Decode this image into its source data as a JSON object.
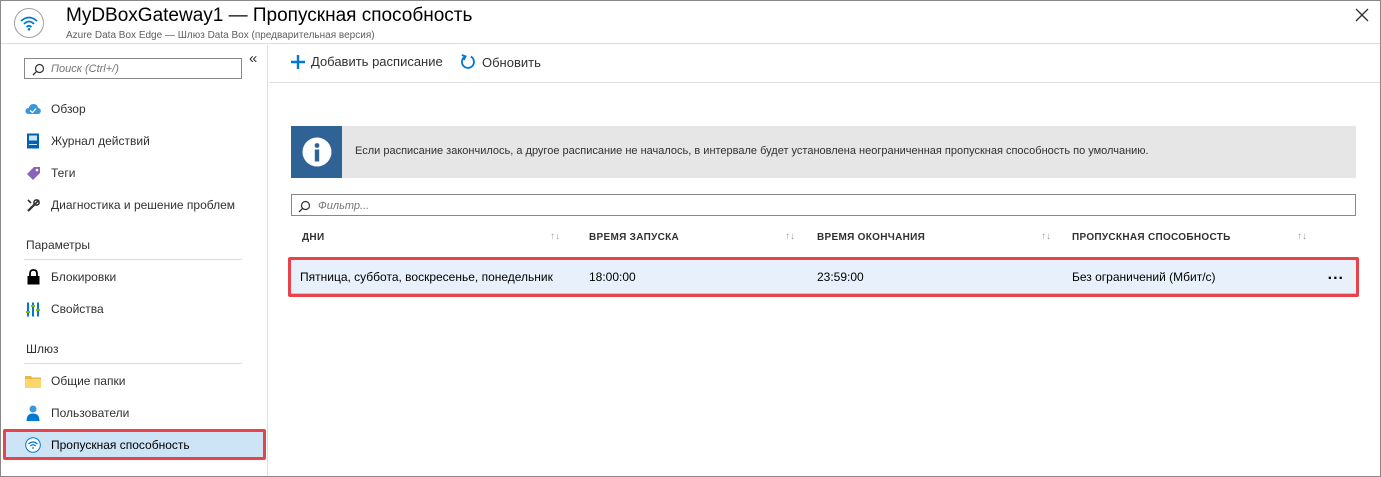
{
  "header": {
    "title": "MyDBoxGateway1 — Пропускная способность",
    "subtitle": "Azure Data Box Edge — Шлюз Data Box (предварительная версия)",
    "icon": "wifi-icon",
    "close_icon": "close-icon"
  },
  "sidebar": {
    "search_placeholder": "Поиск (Ctrl+/)",
    "collapse_label": "«",
    "items": [
      {
        "label": "Обзор",
        "icon": "cloud-icon"
      },
      {
        "label": "Журнал действий",
        "icon": "journal-icon"
      },
      {
        "label": "Теги",
        "icon": "tag-icon"
      },
      {
        "label": "Диагностика и решение проблем",
        "icon": "wrench-icon"
      }
    ],
    "section_parameters": "Параметры",
    "parameter_items": [
      {
        "label": "Блокировки",
        "icon": "lock-icon"
      },
      {
        "label": "Свойства",
        "icon": "properties-icon"
      }
    ],
    "section_gateway": "Шлюз",
    "gateway_items": [
      {
        "label": "Общие папки",
        "icon": "folder-icon"
      },
      {
        "label": "Пользователи",
        "icon": "user-icon"
      },
      {
        "label": "Пропускная способность",
        "icon": "wifi-icon",
        "active": true
      }
    ]
  },
  "toolbar": {
    "add_schedule": "Добавить расписание",
    "refresh": "Обновить"
  },
  "info": {
    "text": "Если расписание закончилось, а другое расписание не началось, в интервале будет установлена неограниченная пропускная способность по умолчанию."
  },
  "filter": {
    "placeholder": "Фильтр..."
  },
  "table": {
    "columns": [
      "ДНИ",
      "ВРЕМЯ ЗАПУСКА",
      "ВРЕМЯ ОКОНЧАНИЯ",
      "ПРОПУСКНАЯ СПОСОБНОСТЬ"
    ],
    "sort_glyph": "↑↓",
    "rows": [
      {
        "days": "Пятница, суббота, воскресенье, понедельник",
        "start": "18:00:00",
        "end": "23:59:00",
        "bandwidth": "Без ограничений (Мбит/с)",
        "more": "..."
      }
    ]
  },
  "colors": {
    "accent": "#0078d4",
    "highlight": "#e8434a",
    "info_icon_bg": "#2f6396",
    "active_nav": "#cce4f6"
  }
}
